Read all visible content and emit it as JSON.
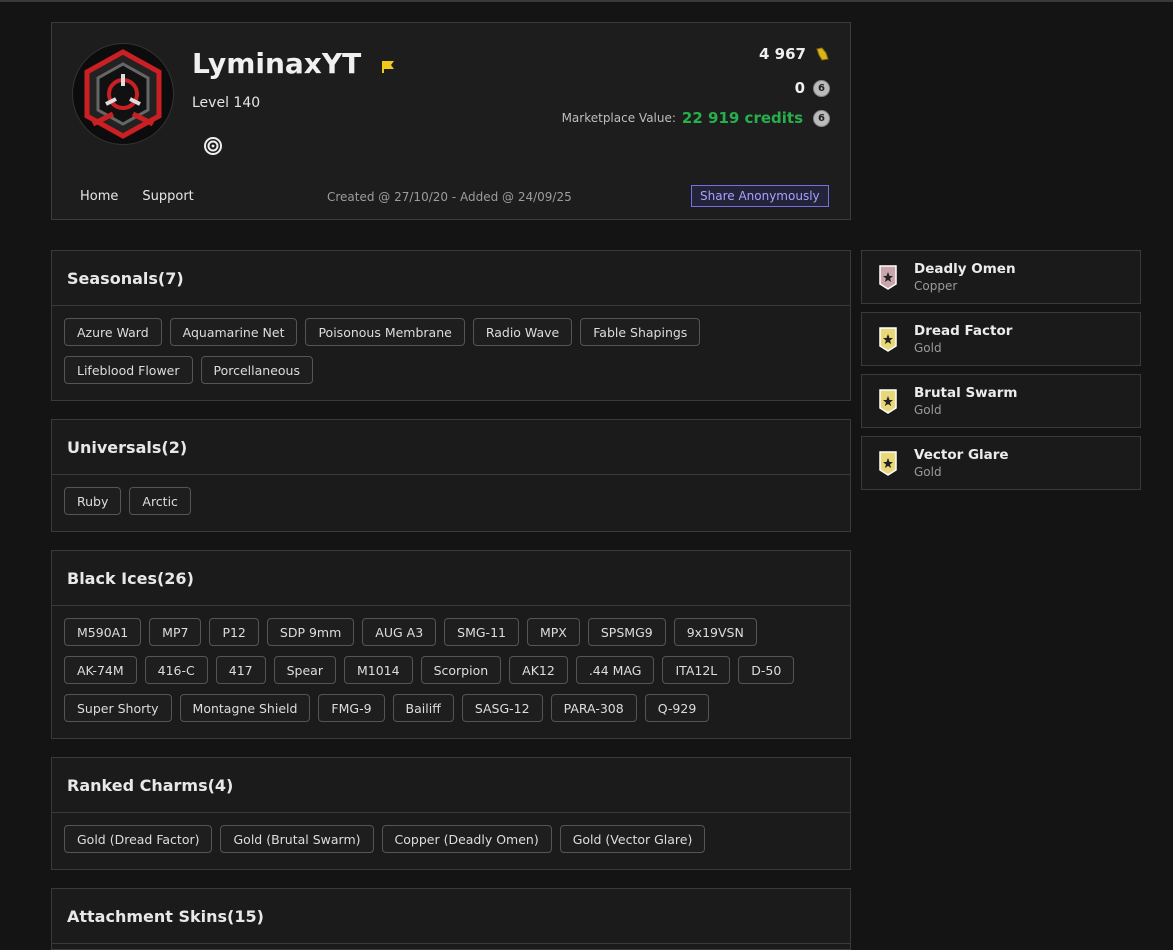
{
  "profile": {
    "username": "LyminaxYT",
    "level": "Level 140",
    "renown": "4 967",
    "r6_credits": "0",
    "marketplace_label": "Marketplace Value:",
    "marketplace_value": "22 919 credits",
    "created": "Created @ 27/10/20 - Added @ 24/09/25",
    "nav": [
      "Home",
      "Support"
    ],
    "share_label": "Share Anonymously",
    "colors": {
      "accent_green": "#26b04c",
      "share_accent": "#7570e0",
      "flag": "#f2c81a"
    },
    "icons": [
      "avatar-emblem",
      "flag-icon",
      "ubisoft-icon",
      "renown-icon",
      "r6-credits-icon"
    ]
  },
  "sections": [
    {
      "title": "Seasonals",
      "count": "(7)",
      "items": [
        "Azure Ward",
        "Aquamarine Net",
        "Poisonous Membrane",
        "Radio Wave",
        "Fable Shapings",
        "Lifeblood Flower",
        "Porcellaneous"
      ]
    },
    {
      "title": "Universals",
      "count": "(2)",
      "items": [
        "Ruby",
        "Arctic"
      ]
    },
    {
      "title": "Black Ices",
      "count": "(26)",
      "items": [
        "M590A1",
        "MP7",
        "P12",
        "SDP 9mm",
        "AUG A3",
        "SMG-11",
        "MPX",
        "SPSMG9",
        "9x19VSN",
        "AK-74M",
        "416-C",
        "417",
        "Spear",
        "M1014",
        "Scorpion",
        "AK12",
        ".44 MAG",
        "ITA12L",
        "D-50",
        "Super Shorty",
        "Montagne Shield",
        "FMG-9",
        "Bailiff",
        "SASG-12",
        "PARA-308",
        "Q-929"
      ]
    },
    {
      "title": "Ranked Charms",
      "count": "(4)",
      "items": [
        "Gold (Dread Factor)",
        "Gold (Brutal Swarm)",
        "Copper (Deadly Omen)",
        "Gold (Vector Glare)"
      ]
    },
    {
      "title": "Attachment Skins",
      "count": "(15)",
      "items": []
    }
  ],
  "charms": [
    {
      "name": "Deadly Omen",
      "tier": "Copper",
      "color": "#c9a6ad"
    },
    {
      "name": "Dread Factor",
      "tier": "Gold",
      "color": "#e8d87a"
    },
    {
      "name": "Brutal Swarm",
      "tier": "Gold",
      "color": "#e8d87a"
    },
    {
      "name": "Vector Glare",
      "tier": "Gold",
      "color": "#e8d87a"
    }
  ]
}
